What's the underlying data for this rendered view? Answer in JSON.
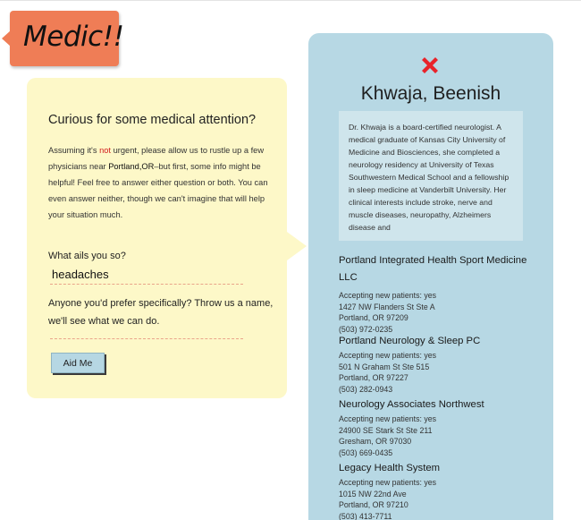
{
  "logo": {
    "text": "Medic!!"
  },
  "form": {
    "title": "Curious for some medical attention?",
    "intro_before": "Assuming it's ",
    "intro_not": "not",
    "intro_middle": " urgent, please allow us to rustle up a few physicians near ",
    "intro_city": "Portland,OR",
    "intro_after": "–but first, some info might be helpful! Feel free to answer either question or both. You can even answer neither, though we can't imagine that will help your situation much.",
    "ails_label": "What ails you so?",
    "ails_value": "headaches",
    "pref_label": "Anyone you'd prefer specifically? Throw us a name, we'll see what we can do.",
    "pref_value": "",
    "button_label": "Aid Me"
  },
  "doctor": {
    "name": "Khwaja, Beenish",
    "bio": "Dr. Khwaja is a board-certified neurologist. A medical graduate of Kansas City University of Medicine and Biosciences, she completed a neurology residency at University of Texas Southwestern Medical School and a fellowship in sleep medicine at Vanderbilt University. Her clinical interests include stroke, nerve and muscle diseases, neuropathy, Alzheimers disease and",
    "practices": [
      {
        "name": "Portland Integrated Health Sport Medicine LLC",
        "accepting": "Accepting new patients: yes",
        "street": "1427 NW Flanders St Ste A",
        "city": "Portland, OR 97209",
        "phone": "(503) 972-0235"
      },
      {
        "name": "Portland Neurology & Sleep PC",
        "accepting": "Accepting new patients: yes",
        "street": "501 N Graham St Ste 515",
        "city": "Portland, OR 97227",
        "phone": "(503) 282-0943"
      },
      {
        "name": "Neurology Associates Northwest",
        "accepting": "Accepting new patients: yes",
        "street": "24900 SE Stark St Ste 211",
        "city": "Gresham, OR 97030",
        "phone": "(503) 669-0435"
      },
      {
        "name": "Legacy Health System",
        "accepting": "Accepting new patients: yes",
        "street": "1015 NW 22nd Ave",
        "city": "Portland, OR 97210",
        "phone": "(503) 413-7711"
      }
    ]
  },
  "colors": {
    "logo": "#ef7d56",
    "form_bg": "#fdf8c8",
    "doctor_bg": "#b7d8e4",
    "cross": "#e8232a",
    "button": "#b6d7e3"
  },
  "icons": {
    "doctor_icon": "red-cross-icon"
  }
}
